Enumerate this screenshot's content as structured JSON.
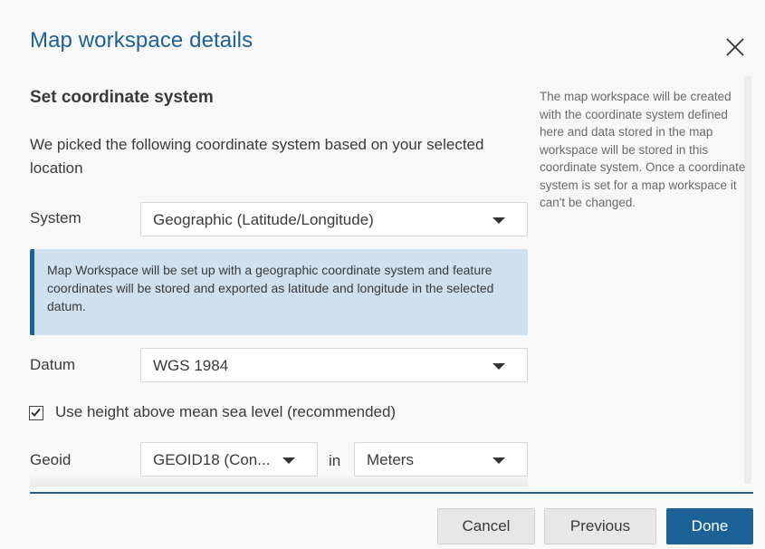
{
  "dialog": {
    "title": "Map workspace details"
  },
  "section": {
    "heading": "Set coordinate system",
    "intro": "We picked the following coordinate system based on your selected location",
    "side_note": "The map workspace will be created with the coordinate system defined here and data stored in the map workspace will be stored in this coordinate system. Once a coordinate system is set for a map workspace it can't be changed."
  },
  "system": {
    "label": "System",
    "value": "Geographic (Latitude/Longitude)"
  },
  "info_box": {
    "text": "Map Workspace will be set up with a geographic coordinate system and feature coordinates will be stored and exported as latitude and longitude in the selected datum."
  },
  "datum": {
    "label": "Datum",
    "value": "WGS 1984"
  },
  "height_option": {
    "label": "Use height above mean sea level (recommended)",
    "checked": true
  },
  "geoid": {
    "label": "Geoid",
    "value": "GEOID18 (Con...",
    "in_label": "in",
    "unit_value": "Meters"
  },
  "footer": {
    "cancel_label": "Cancel",
    "previous_label": "Previous",
    "done_label": "Done"
  },
  "colors": {
    "accent": "#1d6296",
    "info_background": "#cfe0ee",
    "secondary_button": "#e7e7e7"
  },
  "icons": {
    "close": "close-icon",
    "dropdown": "chevron-down-icon",
    "check": "checkmark-icon"
  }
}
